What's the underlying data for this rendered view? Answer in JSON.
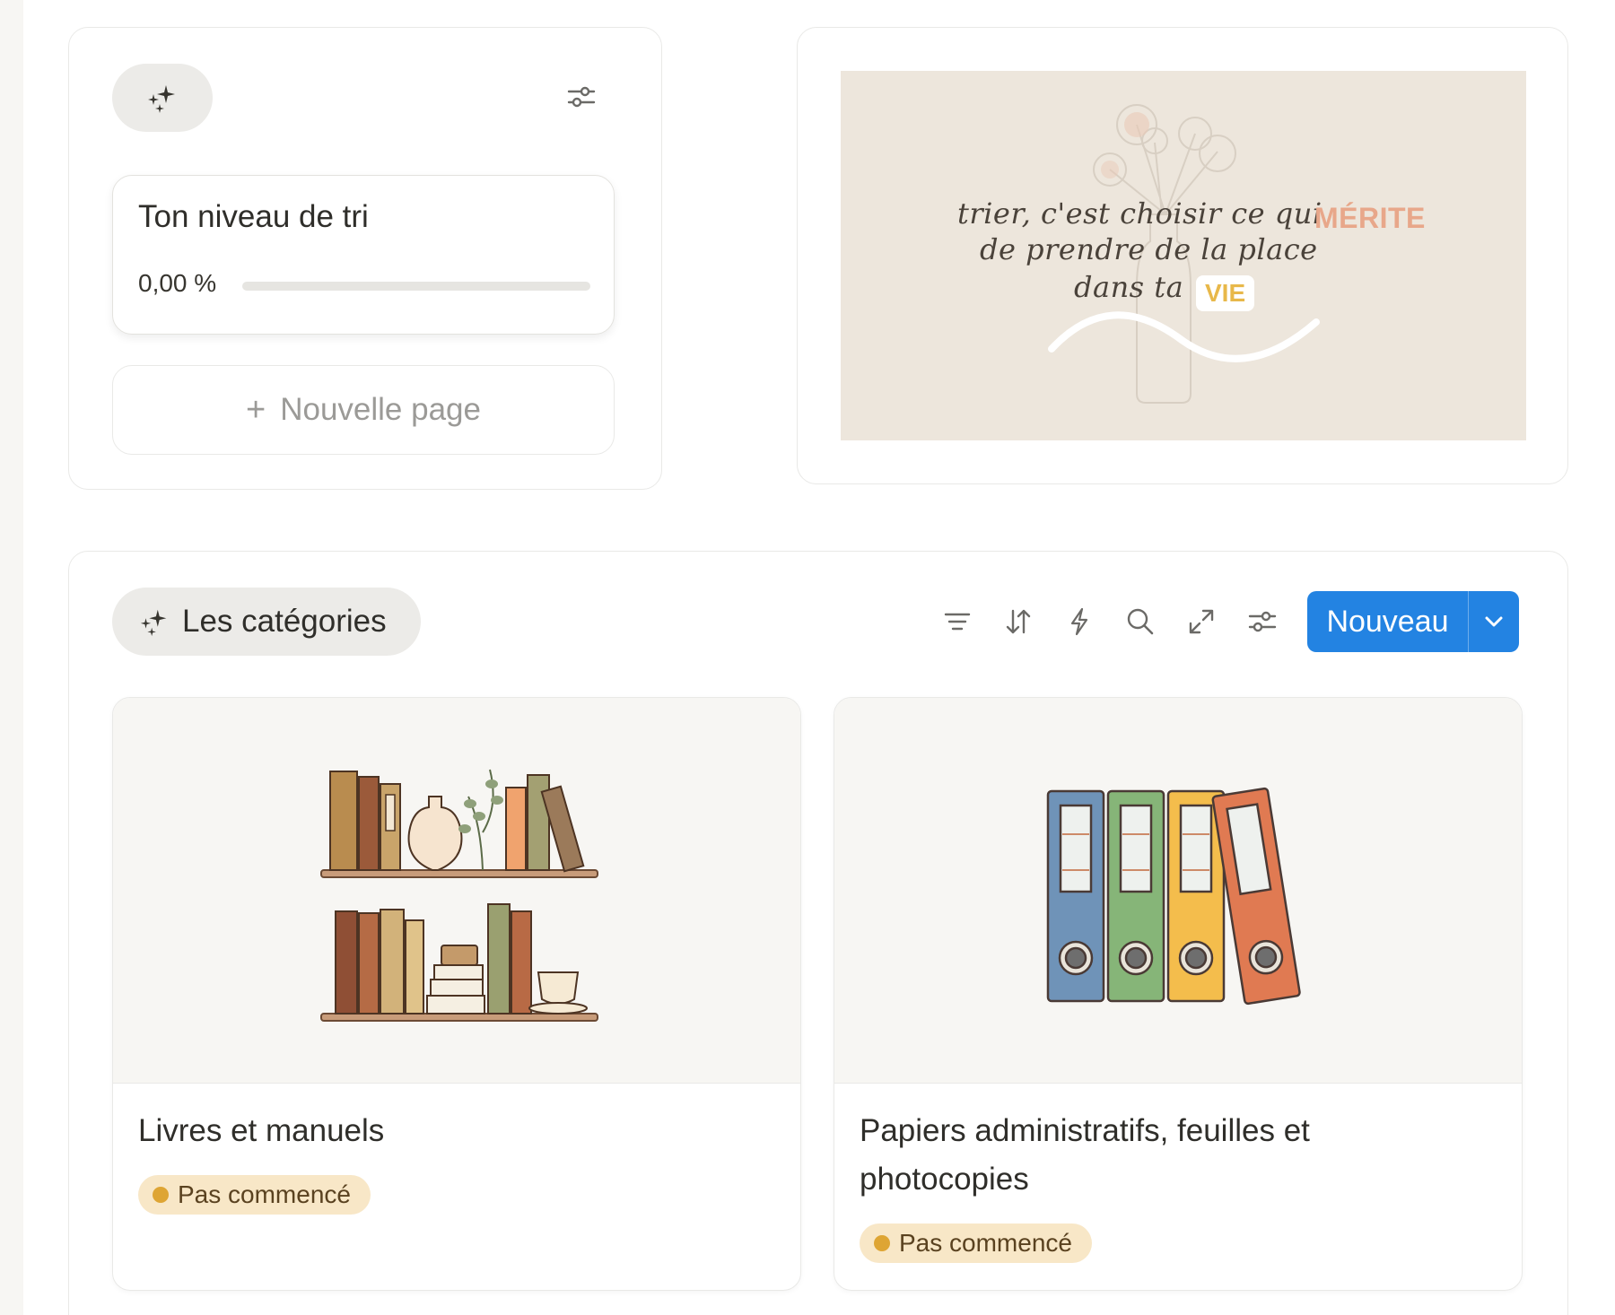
{
  "widget": {
    "progress_title": "Ton niveau de tri",
    "progress_value": "0,00 %",
    "progress_fraction": 0,
    "new_page_label": "Nouvelle page",
    "icons": [
      "sparkles-icon",
      "sliders-icon",
      "plus-icon"
    ]
  },
  "quote": {
    "line1": "trier, c'est choisir ce qui",
    "highlight1": "MÉRITE",
    "line2": "de prendre de la place",
    "line3": "dans ta",
    "highlight2": "VIE",
    "highlight1_color": "#e8a78a",
    "highlight2_color": "#e8b84a"
  },
  "categories": {
    "title": "Les catégories",
    "new_button_label": "Nouveau",
    "toolbar_icons": [
      "filter-icon",
      "sort-icon",
      "lightning-icon",
      "search-icon",
      "expand-icon",
      "sliders-icon"
    ],
    "accent_color": "#2383e2",
    "cards": [
      {
        "title": "Livres et manuels",
        "status": "Pas commencé"
      },
      {
        "title": "Papiers administratifs, feuilles et photocopies",
        "status": "Pas commencé"
      }
    ],
    "status_color": "#dea534"
  }
}
